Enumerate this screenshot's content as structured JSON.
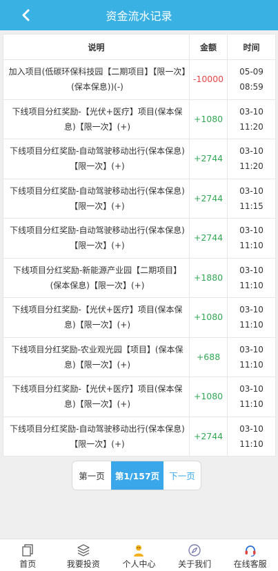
{
  "header": {
    "title": "资金流水记录",
    "back_icon": "chevron-left-icon"
  },
  "table": {
    "columns": [
      "说明",
      "金额",
      "时间"
    ],
    "rows": [
      {
        "desc": "加入项目(低碳环保科技园【二期项目】【限一次】(保本保息))(-)",
        "amount": "-10000",
        "date": "05-09",
        "time": "08:59",
        "sign": "neg"
      },
      {
        "desc": "下线项目分红奖励-【光伏+医疗】项目(保本保息)【限一次】(+)",
        "amount": "+1080",
        "date": "03-10",
        "time": "11:20",
        "sign": "pos"
      },
      {
        "desc": "下线项目分红奖励-自动驾驶移动出行(保本保息)【限一次】(+)",
        "amount": "+2744",
        "date": "03-10",
        "time": "11:20",
        "sign": "pos"
      },
      {
        "desc": "下线项目分红奖励-自动驾驶移动出行(保本保息)【限一次】(+)",
        "amount": "+2744",
        "date": "03-10",
        "time": "11:15",
        "sign": "pos"
      },
      {
        "desc": "下线项目分红奖励-自动驾驶移动出行(保本保息)【限一次】(+)",
        "amount": "+2744",
        "date": "03-10",
        "time": "11:10",
        "sign": "pos"
      },
      {
        "desc": "下线项目分红奖励-新能源产业园【二期项目】(保本保息)【限一次】(+)",
        "amount": "+1880",
        "date": "03-10",
        "time": "11:10",
        "sign": "pos"
      },
      {
        "desc": "下线项目分红奖励-【光伏+医疗】项目(保本保息)【限一次】(+)",
        "amount": "+1080",
        "date": "03-10",
        "time": "11:10",
        "sign": "pos"
      },
      {
        "desc": "下线项目分红奖励-农业观光园【项目】(保本保息)【限一次】(+)",
        "amount": "+688",
        "date": "03-10",
        "time": "11:10",
        "sign": "pos"
      },
      {
        "desc": "下线项目分红奖励-【光伏+医疗】项目(保本保息)【限一次】(+)",
        "amount": "+1080",
        "date": "03-10",
        "time": "11:10",
        "sign": "pos"
      },
      {
        "desc": "下线项目分红奖励-自动驾驶移动出行(保本保息)【限一次】(+)",
        "amount": "+2744",
        "date": "03-10",
        "time": "11:10",
        "sign": "pos"
      }
    ]
  },
  "pager": {
    "first": "第一页",
    "current": "第1/157页",
    "next": "下一页"
  },
  "nav": [
    {
      "label": "首页",
      "icon": "home-icon"
    },
    {
      "label": "我要投资",
      "icon": "layers-icon"
    },
    {
      "label": "个人中心",
      "icon": "user-icon"
    },
    {
      "label": "关于我们",
      "icon": "compass-icon"
    },
    {
      "label": "在线客服",
      "icon": "headset-icon"
    }
  ],
  "colors": {
    "accent": "#39b1e3",
    "negative": "#e64545",
    "positive": "#33a854"
  }
}
